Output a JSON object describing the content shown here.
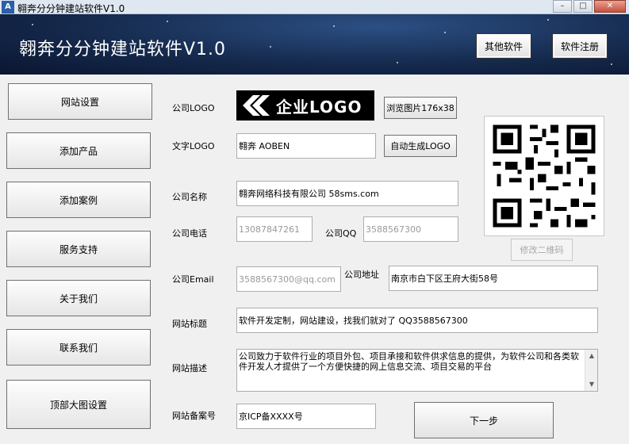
{
  "window": {
    "title": "翱奔分分钟建站软件V1.0",
    "icon_text": "A",
    "minimize": "–",
    "maximize": "□",
    "close": "✕"
  },
  "header": {
    "title": "翱奔分分钟建站软件V1.0",
    "other_software": "其他软件",
    "register": "软件注册"
  },
  "sidebar": {
    "items": [
      {
        "label": "网站设置"
      },
      {
        "label": "添加产品"
      },
      {
        "label": "添加案例"
      },
      {
        "label": "服务支持"
      },
      {
        "label": "关于我们"
      },
      {
        "label": "联系我们"
      },
      {
        "label": "顶部大图设置"
      }
    ]
  },
  "form": {
    "logo_label": "公司LOGO",
    "logo_text": "企业LOGO",
    "browse_button": "浏览图片176x38",
    "text_logo_label": "文字LOGO",
    "text_logo_value": "翱奔 AOBEN",
    "auto_logo_button": "自动生成LOGO",
    "company_name_label": "公司名称",
    "company_name_value": "翱奔网络科技有限公司 58sms.com",
    "phone_label": "公司电话",
    "phone_placeholder": "13087847261",
    "qq_label": "公司QQ",
    "qq_placeholder": "3588567300",
    "email_label": "公司Email",
    "email_placeholder": "3588567300@qq.com",
    "address_label": "公司地址",
    "address_value": "南京市白下区王府大街58号",
    "site_title_label": "网站标题",
    "site_title_value": "软件开发定制，网站建设，找我们就对了 QQ3588567300",
    "site_desc_label": "网站描述",
    "site_desc_value": "公司致力于软件行业的项目外包、项目承接和软件供求信息的提供，为软件公司和各类软件开发人才提供了一个方便快捷的网上信息交流、项目交易的平台",
    "icp_label": "网站备案号",
    "icp_value": "京ICP备XXXX号",
    "next_button": "下一步",
    "qr_button": "修改二维码"
  },
  "colors": {
    "header_bg": "#152a4d",
    "logo_bg": "#000000",
    "placeholder": "#9a9a9a"
  }
}
